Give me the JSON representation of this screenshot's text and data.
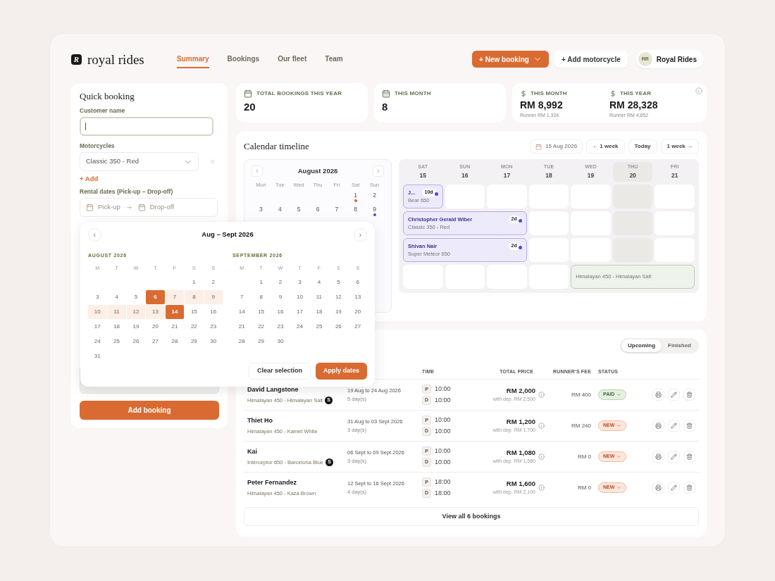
{
  "brand": {
    "logo_letter": "R",
    "name": "royal rides"
  },
  "nav": [
    {
      "label": "Summary",
      "selected": true
    },
    {
      "label": "Bookings",
      "selected": false
    },
    {
      "label": "Our fleet",
      "selected": false
    },
    {
      "label": "Team",
      "selected": false
    }
  ],
  "header_actions": {
    "new_booking": "+ New booking",
    "add_motorcycle": "+ Add motorcycle"
  },
  "user": {
    "initials": "RR",
    "name": "Royal Rides"
  },
  "quick_booking": {
    "title": "Quick booking",
    "customer_label": "Customer name",
    "motorcycle_label": "Motorcycles",
    "motorcycle_value": "Classic 350 - Red",
    "add_link": "+ Add",
    "dates_label": "Rental dates (Pick-up – Drop-off)",
    "pickup_placeholder": "Pick-up",
    "dropoff_placeholder": "Drop-off",
    "submit": "Add booking"
  },
  "stats": [
    {
      "kind": "calendar",
      "label": "TOTAL BOOKINGS THIS YEAR",
      "value": "20"
    },
    {
      "kind": "calendar-day",
      "label": "THIS MONTH",
      "value": "8"
    }
  ],
  "revenue": [
    {
      "label": "THIS MONTH",
      "value": "RM 8,992",
      "sub": "Runner RM 1,324"
    },
    {
      "label": "THIS YEAR",
      "value": "RM 28,328",
      "sub": "Runner RM 4,852"
    }
  ],
  "timeline": {
    "title": "Calendar timeline",
    "date": "15 Aug 2026",
    "buttons": [
      "← 1 week",
      "Today",
      "1 week →"
    ],
    "mini_calendar": {
      "title": "August 2026",
      "weekdays": [
        "Mon",
        "Tue",
        "Wed",
        "Thu",
        "Fri",
        "Sat",
        "Sun"
      ],
      "weeks": [
        {
          "kind": "first",
          "days": [
            {
              "d": "1",
              "color": "#e0622a"
            },
            {
              "d": "2"
            }
          ]
        },
        {
          "days": [
            {
              "d": "3"
            },
            {
              "d": "4"
            },
            {
              "d": "5"
            },
            {
              "d": "6"
            },
            {
              "d": "7"
            },
            {
              "d": "8"
            },
            {
              "d": "9",
              "color": "#4f46e5"
            }
          ]
        }
      ]
    },
    "days": [
      {
        "weekday": "SAT",
        "date": "15",
        "today": false
      },
      {
        "weekday": "SUN",
        "date": "16",
        "today": false
      },
      {
        "weekday": "MON",
        "date": "17",
        "today": false
      },
      {
        "weekday": "TUE",
        "date": "18",
        "today": false
      },
      {
        "weekday": "WED",
        "date": "19",
        "today": false
      },
      {
        "weekday": "THU",
        "date": "20",
        "today": true
      },
      {
        "weekday": "FRI",
        "date": "21",
        "today": false
      }
    ],
    "lanes": [
      {
        "cells": [
          {
            "kind": "event",
            "name": "J...",
            "duration": "10d",
            "bike": "Bear 650",
            "color": "#b6abee"
          },
          {
            "kind": "empty"
          },
          {
            "kind": "empty"
          },
          {
            "kind": "empty"
          },
          {
            "kind": "empty"
          },
          {
            "kind": "empty"
          },
          {
            "kind": "empty"
          }
        ]
      },
      {
        "cells": [
          {
            "kind": "event",
            "name": "Christopher Gerald Wiber",
            "duration": "2d",
            "bike": "Classic 350 - Red",
            "color": "#b6abee"
          },
          {
            "kind": "continue"
          },
          {
            "kind": "continue"
          },
          {
            "kind": "empty"
          },
          {
            "kind": "empty"
          },
          {
            "kind": "empty"
          },
          {
            "kind": "empty"
          }
        ]
      },
      {
        "cells": [
          {
            "kind": "event",
            "name": "Shivan Nair",
            "duration": "2d",
            "bike": "Super Meteor 650",
            "color": "#b6abee"
          },
          {
            "kind": "continue"
          },
          {
            "kind": "continue"
          },
          {
            "kind": "empty"
          },
          {
            "kind": "empty"
          },
          {
            "kind": "empty"
          },
          {
            "kind": "empty"
          }
        ]
      },
      {
        "cells": [
          {
            "kind": "empty"
          },
          {
            "kind": "empty"
          },
          {
            "kind": "empty"
          },
          {
            "kind": "empty"
          },
          {
            "kind": "event",
            "bike": "Himalayan 450 - Himalayan Salt",
            "color": "#b9d1b2"
          },
          {
            "kind": "continue"
          },
          {
            "kind": "continue"
          }
        ]
      }
    ]
  },
  "bookings": {
    "filters": [
      {
        "label": "Upcoming",
        "selected": true
      },
      {
        "label": "Finished",
        "selected": false
      }
    ],
    "columns": [
      "TIME",
      "TOTAL PRICE",
      "RUNNER'S FEE",
      "STATUS"
    ],
    "rows": [
      {
        "name": "David Langstone",
        "bike": "Himalayan 450 - Himalayan Salt",
        "badge": "S",
        "dates": "19 Aug to 24 Aug 2026",
        "days": "5 day(s)",
        "pickup_tag": "P",
        "pickup": "10:00",
        "dropoff_tag": "D",
        "dropoff": "10:00",
        "price": "RM 2,000",
        "deposit": "with dep. RM 2,500",
        "fee": "RM 400",
        "status": {
          "kind": "paid",
          "label": "PAID"
        }
      },
      {
        "name": "Thiet Ho",
        "bike": "Himalayan 450 - Kamet White",
        "dates": "31 Aug to 03 Sept 2026",
        "days": "3 day(s)",
        "pickup_tag": "P",
        "pickup": "10:00",
        "dropoff_tag": "D",
        "dropoff": "10:00",
        "price": "RM 1,200",
        "deposit": "with dep. RM 1,700",
        "fee": "RM 240",
        "status": {
          "kind": "new",
          "label": "NEW"
        }
      },
      {
        "name": "Kai",
        "bike": "Interceptor 650 - Barcelona Blue",
        "badge": "S",
        "dates": "06 Sept to 09 Sept 2026",
        "days": "3 day(s)",
        "pickup_tag": "P",
        "pickup": "10:00",
        "dropoff_tag": "D",
        "dropoff": "10:00",
        "price": "RM 1,080",
        "deposit": "with dep. RM 1,580",
        "fee": "RM 0",
        "status": {
          "kind": "new",
          "label": "NEW"
        }
      },
      {
        "name": "Peter Fernandez",
        "bike": "Himalayan 450 - Kaza Brown",
        "dates": "12 Sept to 16 Sept 2026",
        "days": "4 day(s)",
        "pickup_tag": "P",
        "pickup": "18:00",
        "dropoff_tag": "D",
        "dropoff": "18:00",
        "price": "RM 1,600",
        "deposit": "with dep. RM 2,100",
        "fee": "RM 0",
        "status": {
          "kind": "new",
          "label": "NEW"
        }
      }
    ],
    "view_all": "View all 6 bookings"
  },
  "date_picker": {
    "title": "Aug – Sept 2026",
    "prev": "‹",
    "next": "›",
    "months": [
      {
        "title": "AUGUST 2026",
        "weekdays": [
          "M",
          "T",
          "W",
          "T",
          "F",
          "S",
          "S"
        ],
        "weeks": [
          {
            "kind": "first",
            "days": [
              "1",
              "2"
            ]
          },
          {
            "days": [
              "3",
              "4",
              "5",
              {
                "d": "6",
                "kind": "start"
              },
              {
                "d": "7",
                "kind": "in"
              },
              {
                "d": "8",
                "kind": "in"
              },
              {
                "d": "9",
                "kind": "in"
              }
            ]
          },
          {
            "days": [
              {
                "d": "10",
                "kind": "in"
              },
              {
                "d": "11",
                "kind": "in"
              },
              {
                "d": "12",
                "kind": "in"
              },
              {
                "d": "13",
                "kind": "in"
              },
              {
                "d": "14",
                "kind": "end"
              },
              "15",
              "16"
            ]
          },
          {
            "days": [
              "17",
              "18",
              "19",
              "20",
              "21",
              "22",
              "23"
            ]
          },
          {
            "days": [
              "24",
              "25",
              "26",
              "27",
              "28",
              "29",
              "30"
            ]
          },
          {
            "kind": "last",
            "days": [
              "31"
            ]
          }
        ]
      },
      {
        "title": "SEPTEMBER 2026",
        "weekdays": [
          "M",
          "T",
          "W",
          "T",
          "F",
          "S",
          "S"
        ],
        "weeks": [
          {
            "kind": "first",
            "days": [
              "1",
              "2",
              "3",
              "4",
              "5",
              "6"
            ]
          },
          {
            "days": [
              "7",
              "8",
              "9",
              "10",
              "11",
              "12",
              "13"
            ]
          },
          {
            "days": [
              "14",
              "15",
              "16",
              "17",
              "18",
              "19",
              "20"
            ]
          },
          {
            "days": [
              "21",
              "22",
              "23",
              "24",
              "25",
              "26",
              "27"
            ]
          },
          {
            "kind": "last",
            "days": [
              "28",
              "29",
              "30"
            ]
          }
        ]
      }
    ],
    "clear": "Clear selection",
    "apply": "Apply dates"
  }
}
